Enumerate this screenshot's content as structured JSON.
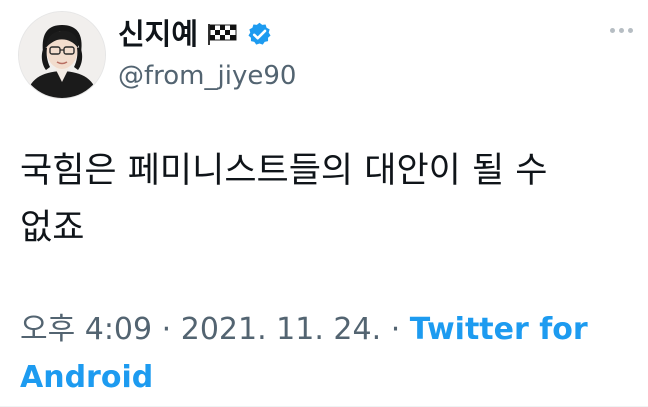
{
  "author": {
    "display_name": "신지예",
    "handle": "@from_jiye90",
    "badge_icon": "checkered-flag-icon",
    "verified_icon": "verified-badge-icon",
    "verified_color": "#1d9bf0"
  },
  "tweet": {
    "text": "국힘은 페미니스트들의 대안이 될 수 없죠",
    "time": "오후 4:09",
    "separator": "·",
    "date": "2021. 11. 24.",
    "source": "Twitter for Android"
  },
  "colors": {
    "text": "#0f1419",
    "secondary": "#536471",
    "link": "#1d9bf0"
  }
}
